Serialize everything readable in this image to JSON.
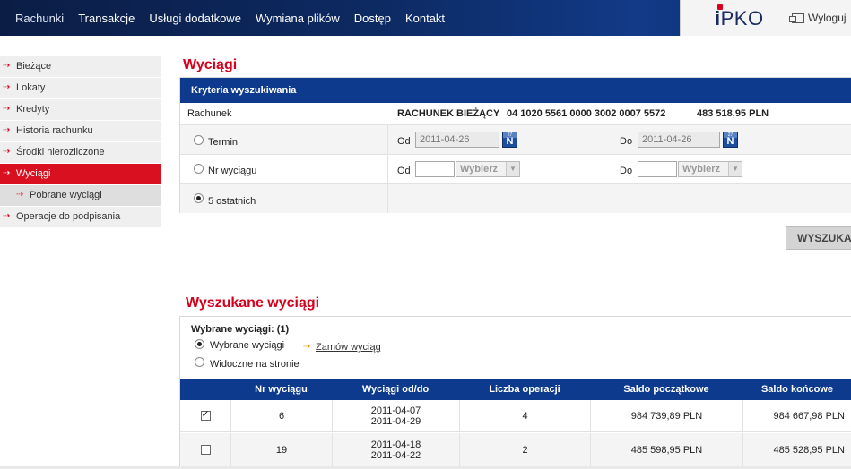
{
  "nav": {
    "items": [
      "Rachunki",
      "Transakcje",
      "Usługi dodatkowe",
      "Wymiana plików",
      "Dostęp",
      "Kontakt"
    ],
    "active": "Rachunki"
  },
  "brand": {
    "logo_i": "i",
    "logo_rest": "PKO",
    "logout_label": "Wyloguj"
  },
  "sidebar": {
    "items": [
      {
        "label": "Bieżące"
      },
      {
        "label": "Lokaty"
      },
      {
        "label": "Kredyty"
      },
      {
        "label": "Historia rachunku"
      },
      {
        "label": "Środki nierozliczone"
      },
      {
        "label": "Wyciągi"
      },
      {
        "label": "Pobrane wyciągi"
      },
      {
        "label": "Operacje do podpisania"
      }
    ]
  },
  "criteria": {
    "page_title": "Wyciągi",
    "header": "Kryteria wyszukiwania",
    "account_label": "Rachunek",
    "account_name": "RACHUNEK BIEŻĄCY",
    "account_number": "04 1020 5561 0000 3002 0007 5572",
    "account_balance": "483 518,95 PLN",
    "term_label": "Termin",
    "from_label": "Od",
    "to_label": "Do",
    "date_from": "2011-04-26",
    "date_to": "2011-04-26",
    "cal_day": "27",
    "cal_letter": "N",
    "statement_no_label": "Nr wyciągu",
    "select_placeholder": "Wybierz",
    "last5_label": "5 ostatnich",
    "search_button": "WYSZUKAJ"
  },
  "results": {
    "title": "Wyszukane wyciągi",
    "selected_count_label": "Wybrane wyciągi: (1)",
    "option_selected": "Wybrane wyciągi",
    "option_visible": "Widoczne na stronie",
    "order_link": "Zamów wyciąg",
    "columns": [
      "",
      "Nr wyciągu",
      "Wyciągi od/do",
      "Liczba operacji",
      "Saldo początkowe",
      "Saldo końcowe"
    ],
    "rows": [
      {
        "checked": true,
        "number": "6",
        "date_from": "2011-04-07",
        "date_to": "2011-04-29",
        "operations": "4",
        "opening": "984 739,89 PLN",
        "closing": "984 667,98 PLN"
      },
      {
        "checked": false,
        "number": "19",
        "date_from": "2011-04-18",
        "date_to": "2011-04-22",
        "operations": "2",
        "opening": "485 598,95 PLN",
        "closing": "485 528,95 PLN"
      }
    ]
  }
}
